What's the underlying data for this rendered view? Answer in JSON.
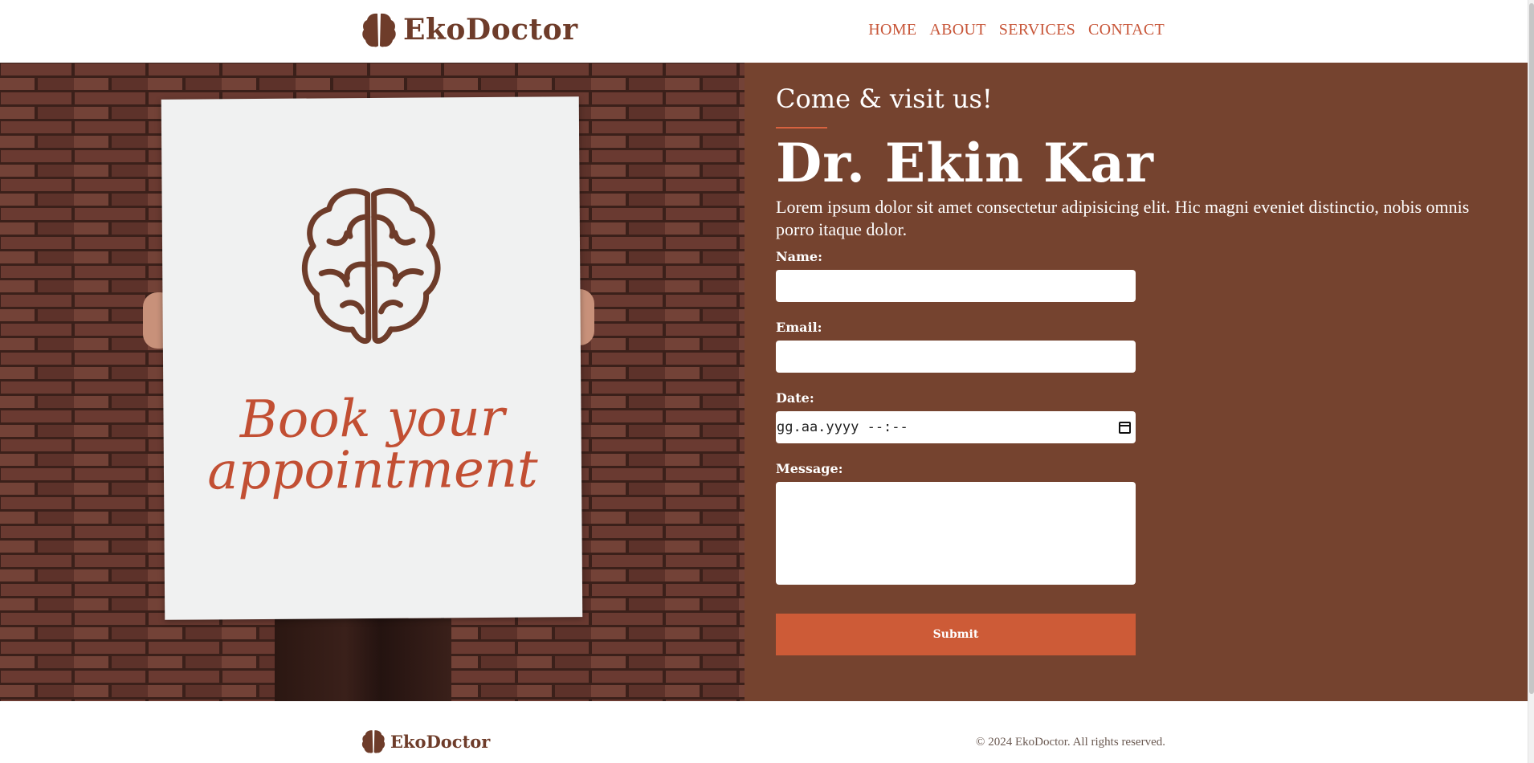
{
  "brand": {
    "name": "EkoDoctor",
    "colors": {
      "primary": "#75432f",
      "accent": "#cd5b37",
      "logo": "#6e3c2a",
      "nav": "#c8573a"
    }
  },
  "nav": {
    "items": [
      {
        "label": "HOME"
      },
      {
        "label": "ABOUT"
      },
      {
        "label": "SERVICES"
      },
      {
        "label": "CONTACT"
      }
    ]
  },
  "hero_image": {
    "icon": "brain-icon",
    "poster_line1": "Book your",
    "poster_line2": "appointment"
  },
  "contact": {
    "eyebrow": "Come & visit us!",
    "doctor_name": "Dr. Ekin Kar",
    "intro": "Lorem ipsum dolor sit amet consectetur adipisicing elit. Hic magni eveniet distinctio, nobis omnis porro itaque dolor.",
    "form": {
      "name_label": "Name:",
      "name_value": "",
      "email_label": "Email:",
      "email_value": "",
      "date_label": "Date:",
      "date_placeholder": "gg.aa.yyyy --:--",
      "message_label": "Message:",
      "message_value": "",
      "submit_label": "Submit"
    }
  },
  "footer": {
    "brand": "EkoDoctor",
    "copyright": "© 2024 EkoDoctor. All rights reserved."
  }
}
